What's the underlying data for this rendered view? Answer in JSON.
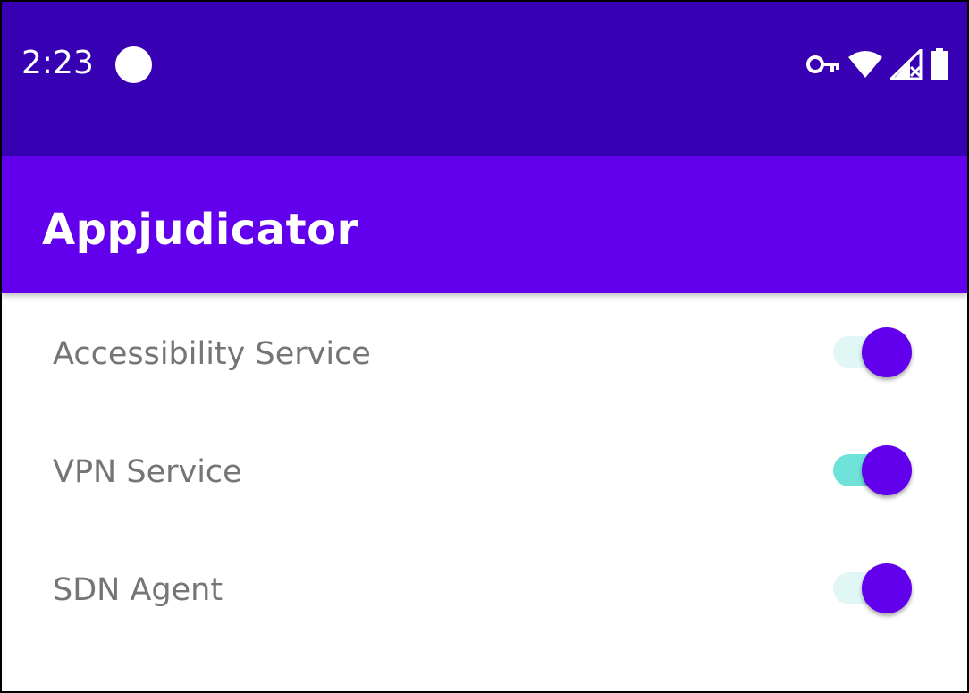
{
  "status_bar": {
    "time": "2:23",
    "icons": [
      "notification-dot-icon",
      "vpn-key-icon",
      "wifi-icon",
      "no-signal-icon",
      "battery-icon"
    ],
    "background_color": "#3700b3"
  },
  "app_bar": {
    "title": "Appjudicator",
    "background_color": "#6200ee"
  },
  "settings": [
    {
      "label": "Accessibility Service",
      "checked": true,
      "track_color": "#e0f7f6",
      "thumb_color": "#6200ee"
    },
    {
      "label": "VPN Service",
      "checked": true,
      "track_color": "#6fe3d9",
      "thumb_color": "#6200ee"
    },
    {
      "label": "SDN Agent",
      "checked": true,
      "track_color": "#e0f7f6",
      "thumb_color": "#6200ee"
    }
  ]
}
